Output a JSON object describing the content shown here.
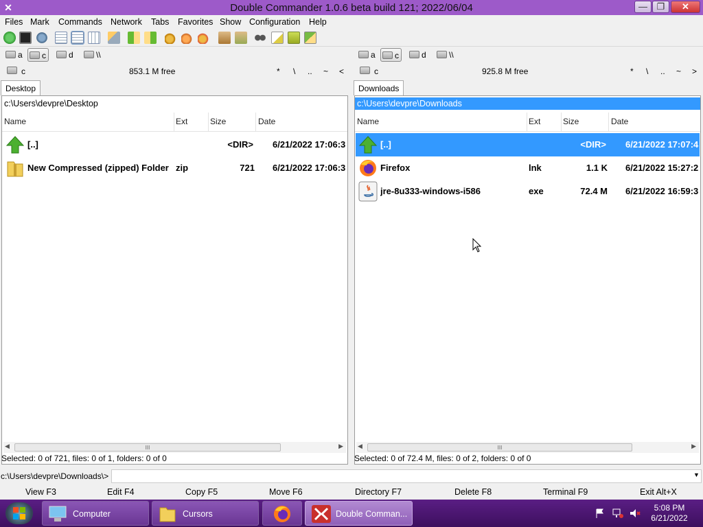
{
  "window": {
    "title": "Double Commander 1.0.6 beta build 121; 2022/06/04",
    "minimize": "—",
    "maximize": "❐",
    "close": "✕"
  },
  "menu": [
    "Files",
    "Mark",
    "Commands",
    "Network",
    "Tabs",
    "Favorites",
    "Show",
    "Configuration",
    "Help"
  ],
  "drives": {
    "items": [
      "a",
      "c",
      "d",
      "\\\\"
    ],
    "selected": "c"
  },
  "left": {
    "drive": "c",
    "free": "853.1 M free",
    "nav": [
      "*",
      "\\",
      "..",
      "~",
      "<"
    ],
    "tab": "Desktop",
    "path": "c:\\Users\\devpre\\Desktop",
    "columns": [
      "Name",
      "Ext",
      "Size",
      "Date"
    ],
    "rows": [
      {
        "name": "[..]",
        "ext": "",
        "size": "<DIR>",
        "date": "6/21/2022 17:06:3",
        "icon": "up-arrow-icon"
      },
      {
        "name": "New Compressed (zipped) Folder",
        "ext": "zip",
        "size": "721",
        "date": "6/21/2022 17:06:3",
        "icon": "zip-folder-icon"
      }
    ],
    "scroll_grip": "III",
    "status": "Selected: 0 of 721, files: 0 of 1, folders: 0 of 0"
  },
  "right": {
    "drive": "c",
    "free": "925.8 M free",
    "nav": [
      "*",
      "\\",
      "..",
      "~",
      ">"
    ],
    "tab": "Downloads",
    "path": "c:\\Users\\devpre\\Downloads",
    "columns": [
      "Name",
      "Ext",
      "Size",
      "Date"
    ],
    "rows": [
      {
        "name": "[..]",
        "ext": "",
        "size": "<DIR>",
        "date": "6/21/2022 17:07:4",
        "icon": "up-arrow-icon",
        "selected": true
      },
      {
        "name": "Firefox",
        "ext": "lnk",
        "size": "1.1 K",
        "date": "6/21/2022 15:27:2",
        "icon": "firefox-icon"
      },
      {
        "name": "jre-8u333-windows-i586",
        "ext": "exe",
        "size": "72.4 M",
        "date": "6/21/2022 16:59:3",
        "icon": "java-icon"
      }
    ],
    "scroll_grip": "III",
    "status": "Selected: 0 of 72.4 M, files: 0 of 2, folders: 0 of 0"
  },
  "cmdline": {
    "prompt": "c:\\Users\\devpre\\Downloads\\>",
    "value": ""
  },
  "fkeys": [
    "View F3",
    "Edit F4",
    "Copy F5",
    "Move F6",
    "Directory F7",
    "Delete F8",
    "Terminal F9",
    "Exit Alt+X"
  ],
  "taskbar": {
    "tasks": [
      {
        "label": "Computer",
        "icon": "computer-icon"
      },
      {
        "label": "Cursors",
        "icon": "folder-icon"
      },
      {
        "label": "",
        "icon": "firefox-icon"
      },
      {
        "label": "Double Comman...",
        "icon": "double-commander-icon",
        "active": true
      }
    ],
    "time": "5:08 PM",
    "date": "6/21/2022"
  },
  "colors": {
    "titlebar": "#9d5ac9",
    "selection": "#3399ff",
    "taskbar": "#4a1670"
  }
}
